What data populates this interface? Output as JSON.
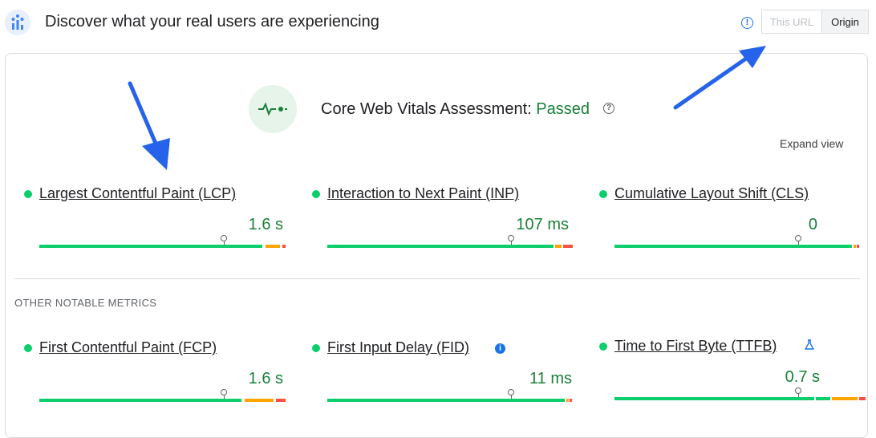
{
  "header": {
    "title": "Discover what your real users are experiencing",
    "info_icon": "info-icon",
    "toggle": {
      "url_label": "This URL",
      "origin_label": "Origin",
      "selected": "Origin"
    }
  },
  "assessment": {
    "label": "Core Web Vitals Assessment:",
    "status": "Passed",
    "status_color": "#188038",
    "expand_label": "Expand view"
  },
  "core_metrics": [
    {
      "name": "Largest Contentful Paint (LCP)",
      "value": "1.6 s"
    },
    {
      "name": "Interaction to Next Paint (INP)",
      "value": "107 ms"
    },
    {
      "name": "Cumulative Layout Shift (CLS)",
      "value": "0"
    }
  ],
  "other_section_label": "OTHER NOTABLE METRICS",
  "other_metrics": [
    {
      "name": "First Contentful Paint (FCP)",
      "value": "1.6 s"
    },
    {
      "name": "First Input Delay (FID)",
      "value": "11 ms"
    },
    {
      "name": "Time to First Byte (TTFB)",
      "value": "0.7 s"
    }
  ],
  "colors": {
    "good": "#0cce6b",
    "needs_improvement": "#ffa400",
    "poor": "#ff4e42",
    "accent": "#1a73e8"
  }
}
